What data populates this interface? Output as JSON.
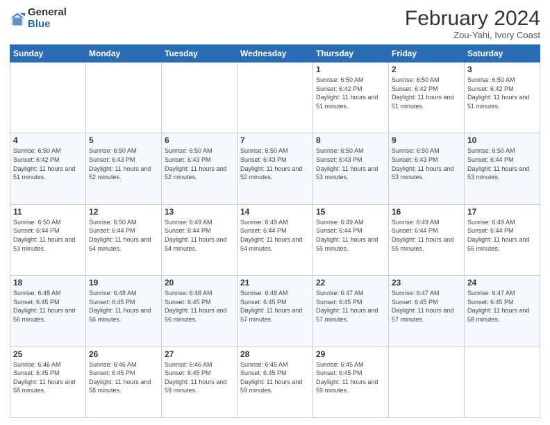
{
  "header": {
    "logo_general": "General",
    "logo_blue": "Blue",
    "month_title": "February 2024",
    "location": "Zou-Yahi, Ivory Coast"
  },
  "days_of_week": [
    "Sunday",
    "Monday",
    "Tuesday",
    "Wednesday",
    "Thursday",
    "Friday",
    "Saturday"
  ],
  "weeks": [
    [
      {
        "day": "",
        "info": ""
      },
      {
        "day": "",
        "info": ""
      },
      {
        "day": "",
        "info": ""
      },
      {
        "day": "",
        "info": ""
      },
      {
        "day": "1",
        "info": "Sunrise: 6:50 AM\nSunset: 6:42 PM\nDaylight: 11 hours and 51 minutes."
      },
      {
        "day": "2",
        "info": "Sunrise: 6:50 AM\nSunset: 6:42 PM\nDaylight: 11 hours and 51 minutes."
      },
      {
        "day": "3",
        "info": "Sunrise: 6:50 AM\nSunset: 6:42 PM\nDaylight: 11 hours and 51 minutes."
      }
    ],
    [
      {
        "day": "4",
        "info": "Sunrise: 6:50 AM\nSunset: 6:42 PM\nDaylight: 11 hours and 51 minutes."
      },
      {
        "day": "5",
        "info": "Sunrise: 6:50 AM\nSunset: 6:43 PM\nDaylight: 11 hours and 52 minutes."
      },
      {
        "day": "6",
        "info": "Sunrise: 6:50 AM\nSunset: 6:43 PM\nDaylight: 11 hours and 52 minutes."
      },
      {
        "day": "7",
        "info": "Sunrise: 6:50 AM\nSunset: 6:43 PM\nDaylight: 11 hours and 52 minutes."
      },
      {
        "day": "8",
        "info": "Sunrise: 6:50 AM\nSunset: 6:43 PM\nDaylight: 11 hours and 53 minutes."
      },
      {
        "day": "9",
        "info": "Sunrise: 6:50 AM\nSunset: 6:43 PM\nDaylight: 11 hours and 53 minutes."
      },
      {
        "day": "10",
        "info": "Sunrise: 6:50 AM\nSunset: 6:44 PM\nDaylight: 11 hours and 53 minutes."
      }
    ],
    [
      {
        "day": "11",
        "info": "Sunrise: 6:50 AM\nSunset: 6:44 PM\nDaylight: 11 hours and 53 minutes."
      },
      {
        "day": "12",
        "info": "Sunrise: 6:50 AM\nSunset: 6:44 PM\nDaylight: 11 hours and 54 minutes."
      },
      {
        "day": "13",
        "info": "Sunrise: 6:49 AM\nSunset: 6:44 PM\nDaylight: 11 hours and 54 minutes."
      },
      {
        "day": "14",
        "info": "Sunrise: 6:49 AM\nSunset: 6:44 PM\nDaylight: 11 hours and 54 minutes."
      },
      {
        "day": "15",
        "info": "Sunrise: 6:49 AM\nSunset: 6:44 PM\nDaylight: 11 hours and 55 minutes."
      },
      {
        "day": "16",
        "info": "Sunrise: 6:49 AM\nSunset: 6:44 PM\nDaylight: 11 hours and 55 minutes."
      },
      {
        "day": "17",
        "info": "Sunrise: 6:49 AM\nSunset: 6:44 PM\nDaylight: 11 hours and 55 minutes."
      }
    ],
    [
      {
        "day": "18",
        "info": "Sunrise: 6:48 AM\nSunset: 6:45 PM\nDaylight: 11 hours and 56 minutes."
      },
      {
        "day": "19",
        "info": "Sunrise: 6:48 AM\nSunset: 6:45 PM\nDaylight: 11 hours and 56 minutes."
      },
      {
        "day": "20",
        "info": "Sunrise: 6:48 AM\nSunset: 6:45 PM\nDaylight: 11 hours and 56 minutes."
      },
      {
        "day": "21",
        "info": "Sunrise: 6:48 AM\nSunset: 6:45 PM\nDaylight: 11 hours and 57 minutes."
      },
      {
        "day": "22",
        "info": "Sunrise: 6:47 AM\nSunset: 6:45 PM\nDaylight: 11 hours and 57 minutes."
      },
      {
        "day": "23",
        "info": "Sunrise: 6:47 AM\nSunset: 6:45 PM\nDaylight: 11 hours and 57 minutes."
      },
      {
        "day": "24",
        "info": "Sunrise: 6:47 AM\nSunset: 6:45 PM\nDaylight: 11 hours and 58 minutes."
      }
    ],
    [
      {
        "day": "25",
        "info": "Sunrise: 6:46 AM\nSunset: 6:45 PM\nDaylight: 11 hours and 58 minutes."
      },
      {
        "day": "26",
        "info": "Sunrise: 6:46 AM\nSunset: 6:45 PM\nDaylight: 11 hours and 58 minutes."
      },
      {
        "day": "27",
        "info": "Sunrise: 6:46 AM\nSunset: 6:45 PM\nDaylight: 11 hours and 59 minutes."
      },
      {
        "day": "28",
        "info": "Sunrise: 6:45 AM\nSunset: 6:45 PM\nDaylight: 11 hours and 59 minutes."
      },
      {
        "day": "29",
        "info": "Sunrise: 6:45 AM\nSunset: 6:45 PM\nDaylight: 11 hours and 59 minutes."
      },
      {
        "day": "",
        "info": ""
      },
      {
        "day": "",
        "info": ""
      }
    ]
  ]
}
